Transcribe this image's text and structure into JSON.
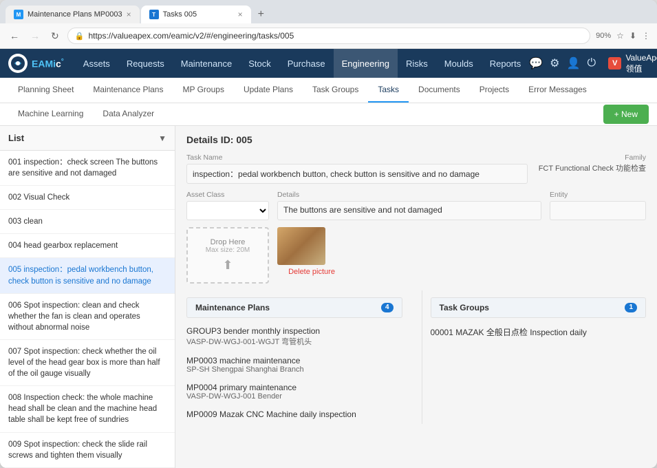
{
  "browser": {
    "tabs": [
      {
        "id": "tab1",
        "label": "Maintenance Plans MP0003",
        "favicon": "M",
        "active": false
      },
      {
        "id": "tab2",
        "label": "Tasks 005",
        "favicon": "T",
        "active": true
      }
    ],
    "url": "https://valueapex.com/eamic/v2/#/engineering/tasks/005",
    "zoom": "90%"
  },
  "header": {
    "logo_text": "EAMic",
    "logo_accent": "°",
    "nav_items": [
      {
        "id": "assets",
        "label": "Assets"
      },
      {
        "id": "requests",
        "label": "Requests"
      },
      {
        "id": "maintenance",
        "label": "Maintenance"
      },
      {
        "id": "stock",
        "label": "Stock"
      },
      {
        "id": "purchase",
        "label": "Purchase"
      },
      {
        "id": "engineering",
        "label": "Engineering",
        "active": true
      },
      {
        "id": "risks",
        "label": "Risks"
      },
      {
        "id": "moulds",
        "label": "Moulds"
      },
      {
        "id": "reports",
        "label": "Reports"
      }
    ],
    "brand": {
      "logo": "V",
      "name": "ValueApex 领值"
    }
  },
  "sub_nav": {
    "row1": [
      {
        "id": "planning-sheet",
        "label": "Planning Sheet"
      },
      {
        "id": "maintenance-plans",
        "label": "Maintenance Plans"
      },
      {
        "id": "mp-groups",
        "label": "MP Groups"
      },
      {
        "id": "update-plans",
        "label": "Update Plans"
      },
      {
        "id": "task-groups",
        "label": "Task Groups"
      },
      {
        "id": "tasks",
        "label": "Tasks",
        "active": true
      },
      {
        "id": "documents",
        "label": "Documents"
      },
      {
        "id": "projects",
        "label": "Projects"
      },
      {
        "id": "error-messages",
        "label": "Error Messages"
      }
    ],
    "row2": [
      {
        "id": "machine-learning",
        "label": "Machine Learning"
      },
      {
        "id": "data-analyzer",
        "label": "Data Analyzer"
      }
    ],
    "new_button": "+ New"
  },
  "list_panel": {
    "title": "List",
    "items": [
      {
        "id": "001",
        "text": "001 inspection：check screen The buttons are sensitive and not damaged",
        "selected": false
      },
      {
        "id": "002",
        "text": "002 Visual Check",
        "selected": false
      },
      {
        "id": "003",
        "text": "003 clean",
        "selected": false
      },
      {
        "id": "004",
        "text": "004 head gearbox replacement",
        "selected": false
      },
      {
        "id": "005",
        "text": "005 inspection：pedal workbench button, check button is sensitive and no damage",
        "selected": true
      },
      {
        "id": "006",
        "text": "006 Spot inspection: clean and check whether the fan is clean and operates without abnormal noise",
        "selected": false
      },
      {
        "id": "007",
        "text": "007 Spot inspection: check whether the oil level of the head gear box is more than half of the oil gauge visually",
        "selected": false
      },
      {
        "id": "008",
        "text": "008 Inspection check: the whole machine head shall be clean and the machine head table shall be kept free of sundries",
        "selected": false
      },
      {
        "id": "009",
        "text": "009 Spot inspection: check the slide rail screws and tighten them visually",
        "selected": false
      }
    ]
  },
  "details": {
    "title": "Details ID: 005",
    "task_name_label": "Task Name",
    "task_name_value": "inspection：pedal workbench button, check button is sensitive and no damage",
    "family_label": "Family",
    "family_value": "FCT Functional Check 功能检查",
    "asset_class_label": "Asset Class",
    "asset_class_value": "",
    "details_label": "Details",
    "details_value": "The buttons are sensitive and not damaged",
    "entity_label": "Entity",
    "entity_value": "",
    "drop_zone_text": "Drop Here",
    "drop_zone_sub": "Max size: 20M",
    "delete_picture_label": "Delete picture",
    "maintenance_plans_section": {
      "label": "Maintenance Plans",
      "count": 4,
      "plans": [
        {
          "name": "GROUP3 bender monthly inspection",
          "sub": "VASP-DW-WGJ-001-WGJT 弯管机头"
        },
        {
          "name": "MP0003 machine maintenance",
          "sub": "SP-SH Shengpai Shanghai Branch"
        },
        {
          "name": "MP0004 primary maintenance",
          "sub": "VASP-DW-WGJ-001 Bender"
        },
        {
          "name": "MP0009 Mazak CNC Machine daily inspection",
          "sub": ""
        }
      ]
    },
    "task_groups_section": {
      "label": "Task Groups",
      "count": 1,
      "groups": [
        {
          "name": "00001 MAZAK 全般日点检 Inspection daily",
          "sub": ""
        }
      ]
    }
  }
}
